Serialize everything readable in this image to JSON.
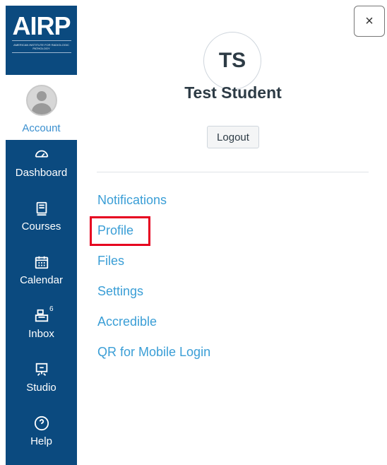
{
  "logo": {
    "text": "AIRP",
    "subtitle": "AMERICAN INSTITUTE FOR RADIOLOGIC PATHOLOGY"
  },
  "account": {
    "label": "Account"
  },
  "nav": {
    "items": [
      {
        "label": "Dashboard",
        "icon": "dashboard-icon"
      },
      {
        "label": "Courses",
        "icon": "courses-icon"
      },
      {
        "label": "Calendar",
        "icon": "calendar-icon"
      },
      {
        "label": "Inbox",
        "icon": "inbox-icon",
        "badge": "6"
      },
      {
        "label": "Studio",
        "icon": "studio-icon"
      },
      {
        "label": "Help",
        "icon": "help-icon"
      }
    ]
  },
  "tray": {
    "close_label": "×",
    "initials": "TS",
    "user_name": "Test Student",
    "logout_label": "Logout",
    "links": [
      {
        "label": "Notifications"
      },
      {
        "label": "Profile"
      },
      {
        "label": "Files"
      },
      {
        "label": "Settings"
      },
      {
        "label": "Accredible"
      },
      {
        "label": "QR for Mobile Login"
      }
    ]
  },
  "colors": {
    "nav_bg": "#0b4a7f",
    "link": "#3a9ed6",
    "highlight": "#e6001f"
  }
}
